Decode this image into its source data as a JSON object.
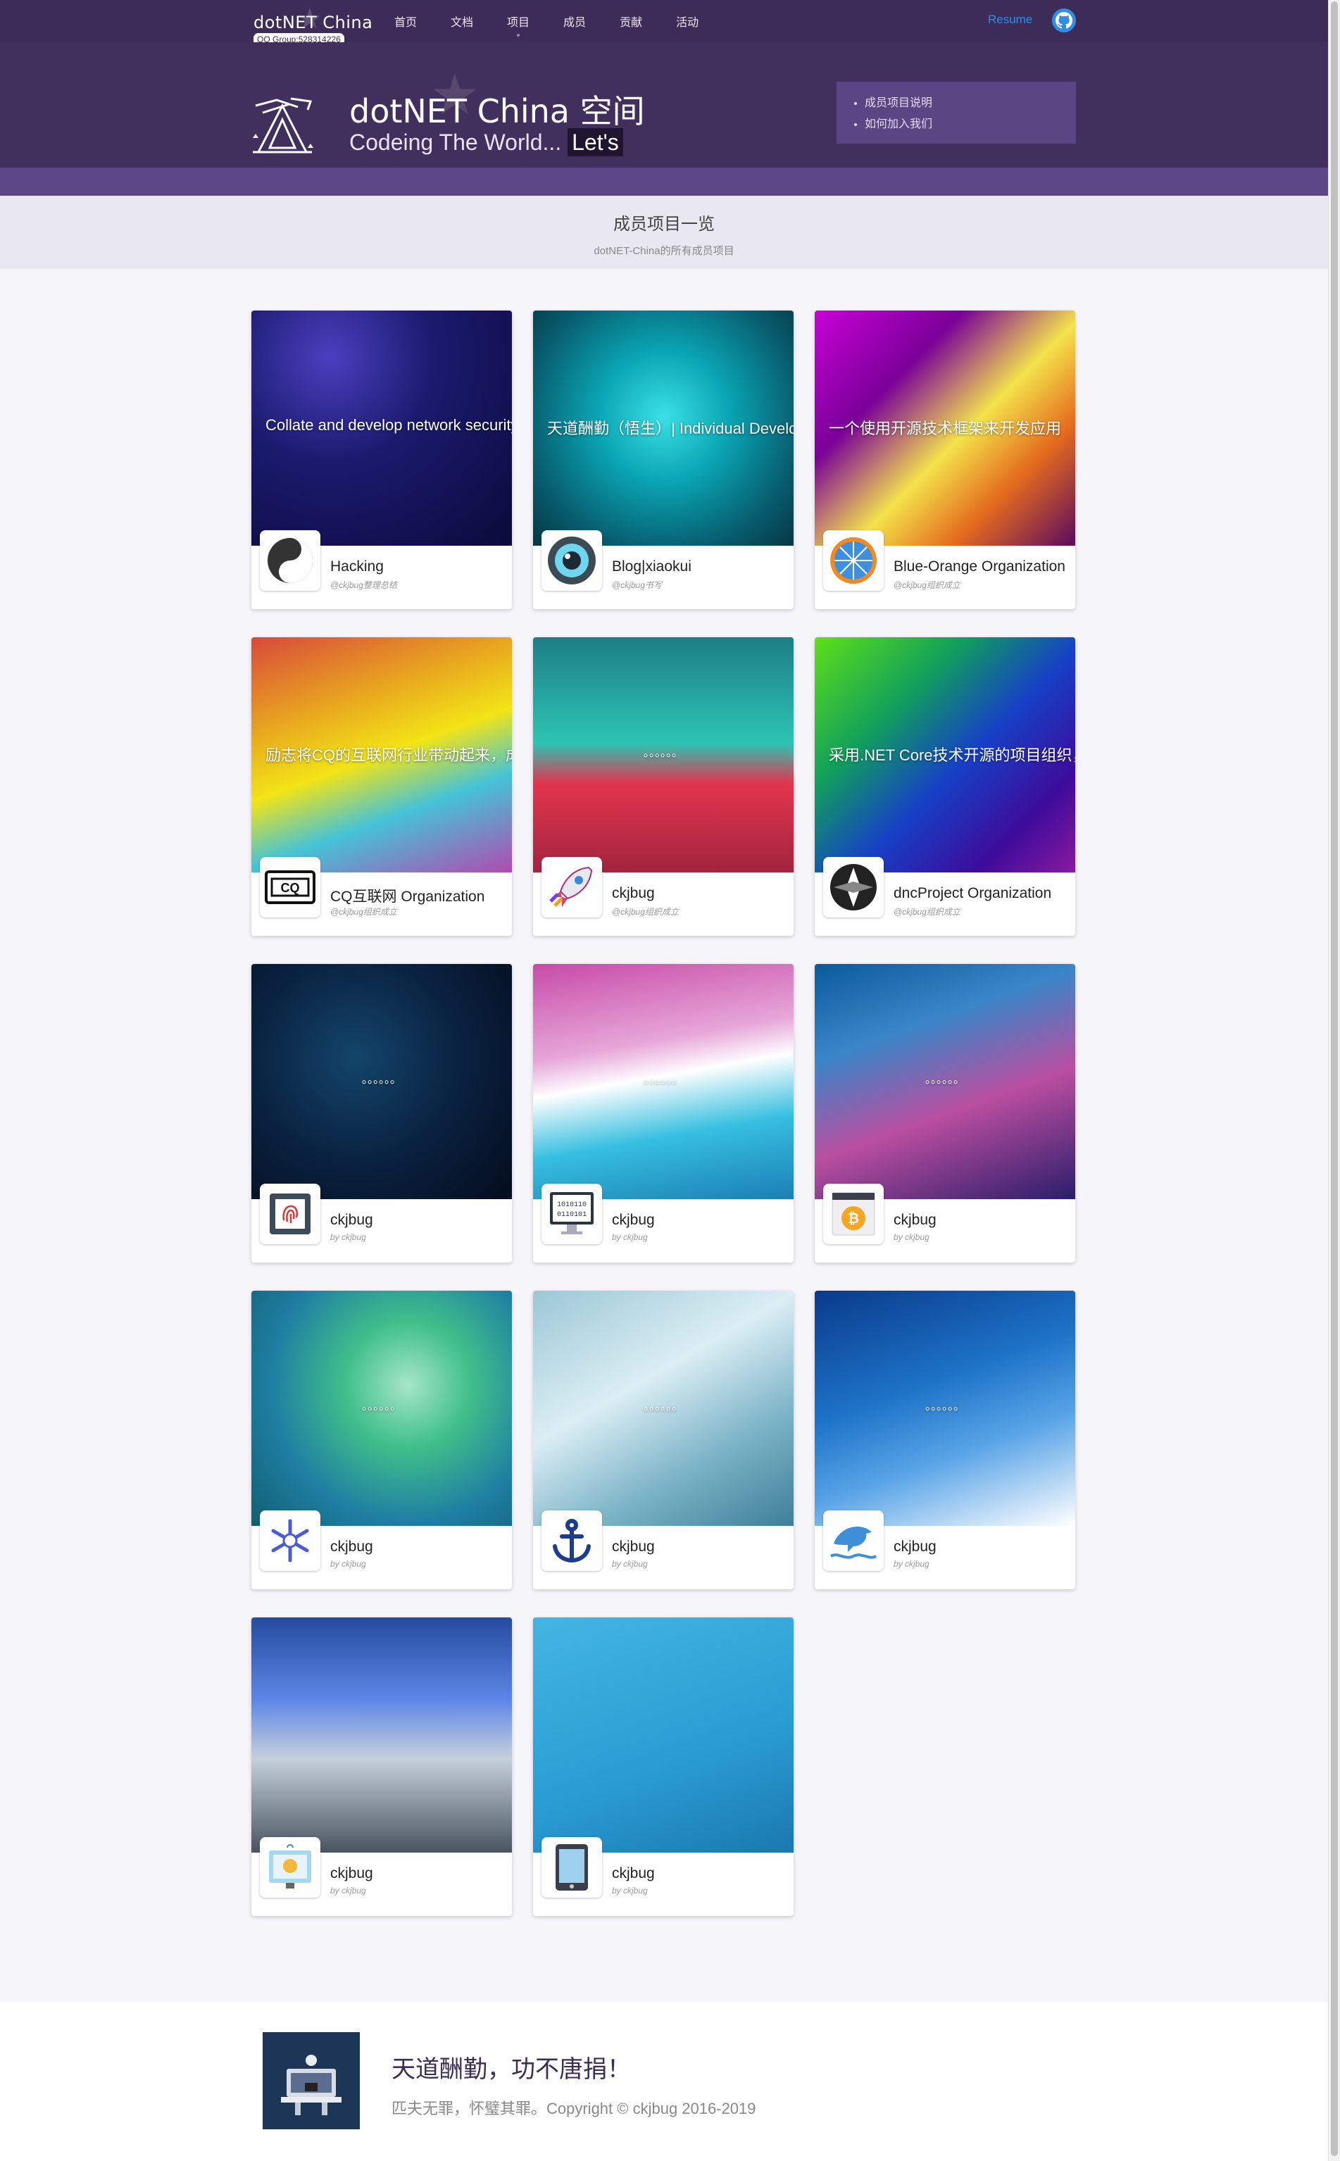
{
  "nav": {
    "logo_text": "dotNET China",
    "qq_group": "QQ Group:528314226",
    "items": [
      "首页",
      "文档",
      "项目",
      "成员",
      "贡献",
      "活动"
    ],
    "active_index": 2,
    "resume": "Resume",
    "github_icon": "github-icon"
  },
  "hero": {
    "title": "dotNET China 空间",
    "subtitle_main": "Codeing The World...",
    "subtitle_highlight": "Let's",
    "side_links": [
      "成员项目说明",
      "如何加入我们"
    ]
  },
  "section": {
    "title": "成员项目一览",
    "subtitle": "dotNET-China的所有成员项目"
  },
  "projects": [
    {
      "name": "Hacking",
      "by": "@ckjbug整理总结",
      "desc": "Collate and develop network security",
      "icon": "yin-yang-icon"
    },
    {
      "name": "Blog|xiaokui",
      "by": "@ckjbug书写",
      "desc": "天道酬勤（悟生）| Individual Developer",
      "icon": "camera-lens-icon"
    },
    {
      "name": "Blue-Orange Organization",
      "by": "@ckjbug组织成立",
      "desc": "一个使用开源技术框架来开发应用",
      "icon": "orange-icon"
    },
    {
      "name": "CQ互联网 Organization",
      "by": "@ckjbug组织成立",
      "desc": "励志将CQ的互联网行业带动起来，成",
      "icon": "cq-icon"
    },
    {
      "name": "ckjbug",
      "by": "@ckjbug组织成立",
      "desc": "。。。。。。",
      "icon": "rocket-icon"
    },
    {
      "name": "dncProject Organization",
      "by": "@ckjbug组织成立",
      "desc": "采用.NET Core技术开源的项目组织，",
      "icon": "dnc-icon"
    },
    {
      "name": "ckjbug",
      "by": "by ckjbug",
      "desc": "。。。。。。",
      "icon": "fingerprint-icon"
    },
    {
      "name": "ckjbug",
      "by": "by ckjbug",
      "desc": "。。。。。。",
      "icon": "binary-monitor-icon"
    },
    {
      "name": "ckjbug",
      "by": "by ckjbug",
      "desc": "。。。。。。",
      "icon": "bitcoin-icon"
    },
    {
      "name": "ckjbug",
      "by": "by ckjbug",
      "desc": "。。。。。。",
      "icon": "snowflake-icon"
    },
    {
      "name": "ckjbug",
      "by": "by ckjbug",
      "desc": "。。。。。。",
      "icon": "anchor-icon"
    },
    {
      "name": "ckjbug",
      "by": "by ckjbug",
      "desc": "。。。。。。",
      "icon": "dolphin-icon"
    },
    {
      "name": "ckjbug",
      "by": "by ckjbug",
      "desc": "",
      "icon": "display-board-icon"
    },
    {
      "name": "ckjbug",
      "by": "by ckjbug",
      "desc": "",
      "icon": "tablet-icon"
    }
  ],
  "footer": {
    "heading": "天道酬勤，功不唐捐！",
    "text": "匹夫无罪，怀璧其罪。Copyright © ckjbug 2016-2019"
  }
}
